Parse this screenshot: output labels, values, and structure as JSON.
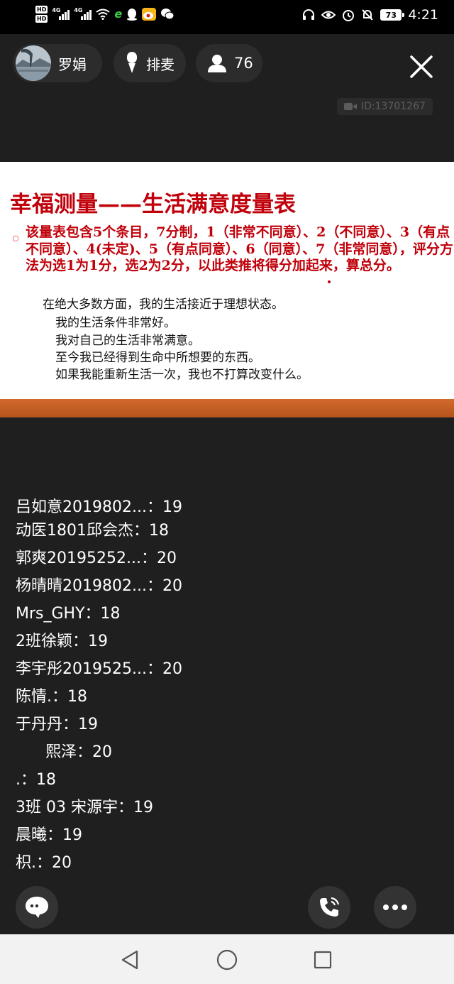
{
  "status_bar": {
    "hd_badges": [
      "HD",
      "HD"
    ],
    "network": [
      "4G",
      "4G"
    ],
    "battery": "73",
    "time": "4:21",
    "icons": [
      "signal-icon",
      "wifi-icon",
      "browser-icon",
      "qq-icon",
      "weibo-icon",
      "wechat-icon",
      "headset-icon",
      "eye-icon",
      "alarm-icon",
      "mute-icon"
    ]
  },
  "top_bar": {
    "host_name": "罗娟",
    "mic_label": "排麦",
    "viewer_count": "76",
    "room_id": "ID:13701267"
  },
  "slide": {
    "title": "幸福测量——生活满意度量表",
    "description": "该量表包含5个条目，7分制，1（非常不同意）、2（不同意）、3（有点不同意）、4(未定)、5（有点同意）、6（同意）、7（非常同意），评分方法为选1为1分，选2为2分，以此类推将得分加起来，算总分。",
    "items": [
      "在绝大多数方面，我的生活接近于理想状态。",
      "我的生活条件非常好。",
      "我对自己的生活非常满意。",
      "至今我已经得到生命中所想要的东西。",
      "如果我能重新生活一次，我也不打算改变什么。"
    ],
    "colors": {
      "title": "#c0000a",
      "stripe": "#c2591f"
    }
  },
  "comments": [
    "吕如意2019802...：19",
    "动医1801邱会杰：18",
    "郭爽20195252...：20",
    "杨晴晴2019802...：20",
    "Mrs_GHY：18",
    "2班徐颖：19",
    "李宇彤2019525...：20",
    "陈情.：18",
    "于丹丹：19",
    "      熙泽：20",
    ".：18",
    "3班 03 宋源宇：19",
    "晨曦：19",
    "枳.：20"
  ],
  "controls": {
    "chat": "chat-bubble-icon",
    "call": "phone-icon",
    "more": "more-icon"
  },
  "nav": [
    "back-icon",
    "home-icon",
    "recents-icon"
  ]
}
